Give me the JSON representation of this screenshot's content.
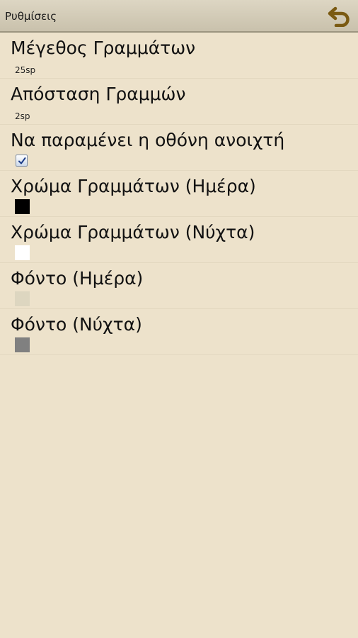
{
  "appbar": {
    "title": "Ρυθμίσεις",
    "back_icon": "back-arrow-icon",
    "accent_color": "#7a5a12"
  },
  "settings": {
    "font_size": {
      "title": "Μέγεθος Γραμμάτων",
      "value": "25sp"
    },
    "line_spacing": {
      "title": "Απόσταση Γραμμών",
      "value": "2sp"
    },
    "keep_screen_on": {
      "title": "Να παραμένει η οθόνη ανοιχτή",
      "checked": true
    },
    "text_color_day": {
      "title": "Χρώμα Γραμμάτων (Ημέρα)",
      "color": "#000000"
    },
    "text_color_night": {
      "title": "Χρώμα Γραμμάτων (Νύχτα)",
      "color": "#ffffff"
    },
    "background_day": {
      "title": "Φόντο (Ημέρα)",
      "color": "#ddd6c0"
    },
    "background_night": {
      "title": "Φόντο (Νύχτα)",
      "color": "#808080"
    }
  }
}
